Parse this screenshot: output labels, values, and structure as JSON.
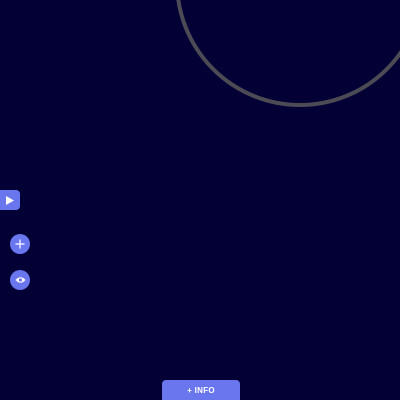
{
  "colors": {
    "background": "#020034",
    "accent": "#6a76ee",
    "ring": "#4b4a55",
    "icon": "#ffffff"
  },
  "controls": {
    "side_tab_icon": "play-icon",
    "zoom_icon": "plus-icon",
    "view_icon": "eye-icon"
  },
  "info_button": {
    "label": "+ INFO"
  }
}
